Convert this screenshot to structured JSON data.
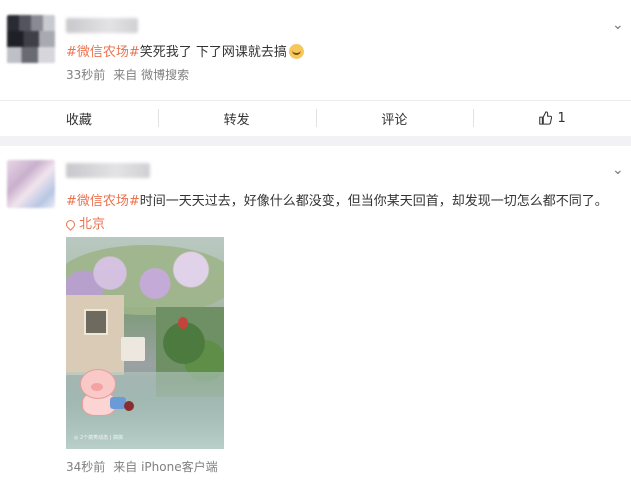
{
  "posts": [
    {
      "topic": "#微信农场#",
      "text": "笑死我了 下了网课就去搞",
      "emoji_icon": "laughing-face-icon",
      "time": "33秒前",
      "source": "来自 微博搜索",
      "actions": {
        "favorite": "收藏",
        "repost": "转发",
        "comment": "评论",
        "like_count": "1"
      }
    },
    {
      "topic": "#微信农场#",
      "text": "时间一天天过去，好像什么都没变，但当你某天回首，却发现一切怎么都不同了。",
      "location": "北京",
      "time": "34秒前",
      "source": "来自 iPhone客户端",
      "image_watermark": "◎ 2个搞笑动态 | 搞搞"
    }
  ],
  "icons": {
    "expand": "chevron-down-icon",
    "like": "thumbs-up-icon",
    "location": "location-pin-icon"
  },
  "colors": {
    "topic": "#eb7350",
    "meta": "#808080",
    "separator": "#f2f2f5"
  }
}
